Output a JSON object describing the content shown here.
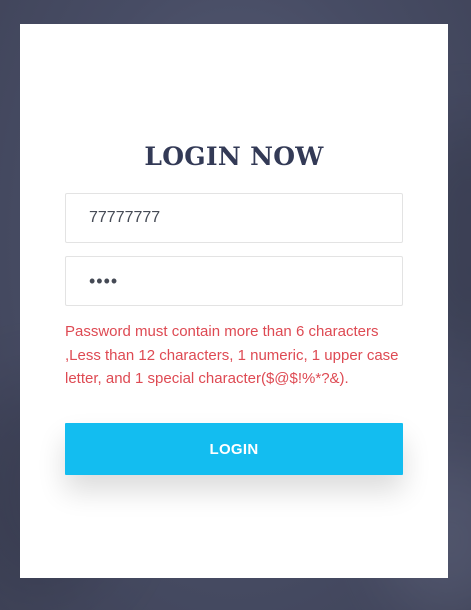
{
  "login": {
    "title": "LOGIN NOW",
    "username_value": "77777777",
    "password_value": "••••",
    "error_message": "Password must contain more than 6 characters ,Less than 12 characters, 1 numeric, 1 upper case letter, and 1 special character($@$!%*?&).",
    "submit_label": "LOGIN"
  },
  "colors": {
    "accent": "#13bdf0",
    "error": "#de4a53",
    "title": "#333a56",
    "background": "#474c64"
  }
}
